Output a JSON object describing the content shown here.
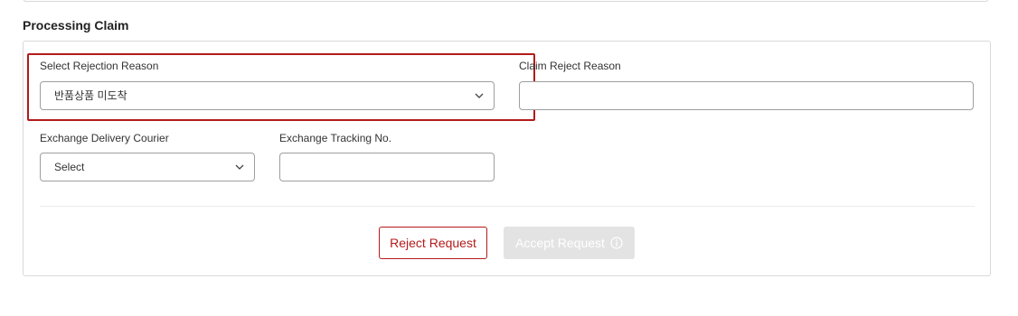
{
  "section": {
    "title": "Processing Claim"
  },
  "rejection_reason": {
    "label": "Select Rejection Reason",
    "selected": "반품상품 미도착",
    "chevron_icon": "chevron-down-icon"
  },
  "claim_reject_reason": {
    "label": "Claim Reject Reason",
    "value": "",
    "placeholder": ""
  },
  "exchange_courier": {
    "label": "Exchange Delivery Courier",
    "selected": "Select",
    "chevron_icon": "chevron-down-icon"
  },
  "exchange_tracking": {
    "label": "Exchange Tracking No.",
    "value": "",
    "placeholder": ""
  },
  "actions": {
    "reject_label": "Reject Request",
    "accept_label": "Accept Request",
    "accept_icon": "info-icon"
  },
  "colors": {
    "accent": "#b31b1b",
    "disabled_button": "#e3e3e3",
    "border": "#9e9e9e"
  }
}
